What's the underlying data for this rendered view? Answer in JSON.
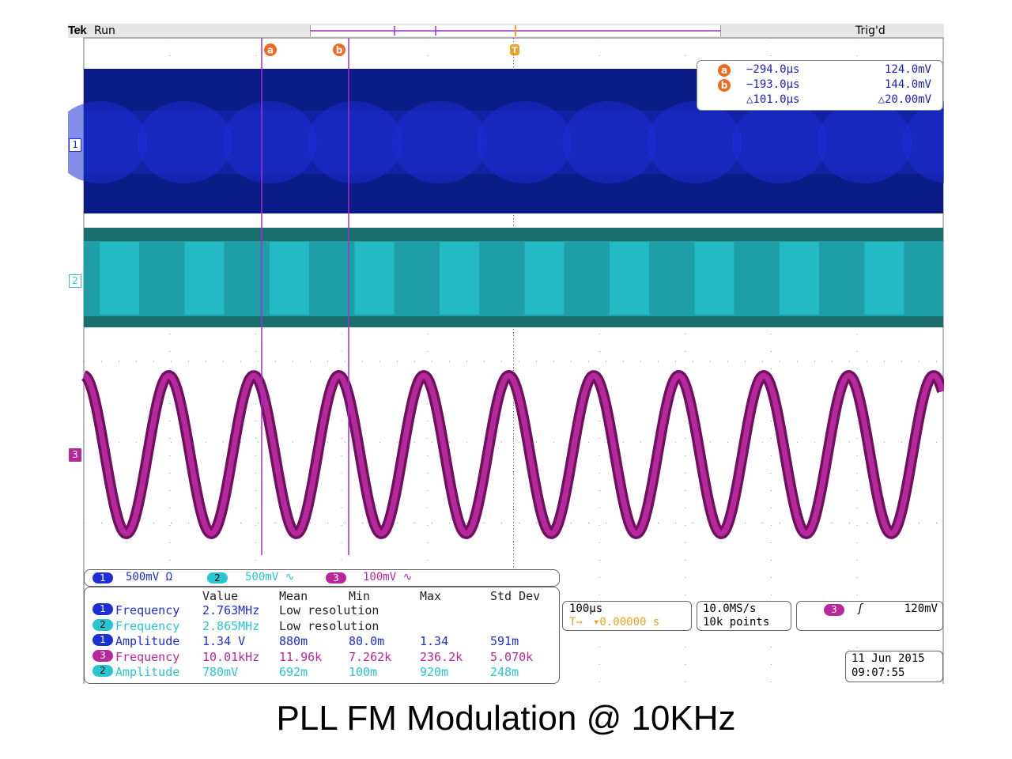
{
  "header": {
    "brand": "Tek",
    "run_state": "Run",
    "trigger_status": "Trig'd"
  },
  "channel_markers": {
    "ch1": "1",
    "ch2": "2",
    "ch3": "3"
  },
  "cursors": {
    "a_label": "a",
    "b_label": "b",
    "trigger_label": "T",
    "readout": {
      "a_time": "−294.0µs",
      "a_volt": "124.0mV",
      "b_time": "−193.0µs",
      "b_volt": "144.0mV",
      "delta_time": "△101.0µs",
      "delta_volt": "△20.00mV"
    }
  },
  "channel_settings": [
    {
      "num": "1",
      "scale": "500mV Ω",
      "color": "#1c2fd6"
    },
    {
      "num": "2",
      "scale": "500mV ∿",
      "color": "#27c6d1"
    },
    {
      "num": "3",
      "scale": "100mV ∿",
      "color": "#b8289d"
    }
  ],
  "measurements": {
    "headers": {
      "value": "Value",
      "mean": "Mean",
      "min": "Min",
      "max": "Max",
      "stddev": "Std Dev"
    },
    "rows": [
      {
        "ch": "1",
        "name": "Frequency",
        "value": "2.763MHz",
        "mean": "Low resolution",
        "min": "",
        "max": "",
        "stddev": "",
        "color": "#1c2fd6"
      },
      {
        "ch": "2",
        "name": "Frequency",
        "value": "2.865MHz",
        "mean": "Low resolution",
        "min": "",
        "max": "",
        "stddev": "",
        "color": "#27c6d1"
      },
      {
        "ch": "1",
        "name": "Amplitude",
        "value": "1.34 V",
        "mean": "880m",
        "min": "80.0m",
        "max": "1.34",
        "stddev": "591m",
        "color": "#1c2fd6"
      },
      {
        "ch": "3",
        "name": "Frequency",
        "value": "10.01kHz",
        "mean": "11.96k",
        "min": "7.262k",
        "max": "236.2k",
        "stddev": "5.070k",
        "color": "#b8289d"
      },
      {
        "ch": "2",
        "name": "Amplitude",
        "value": "780mV",
        "mean": "692m",
        "min": "100m",
        "max": "920m",
        "stddev": "248m",
        "color": "#27c6d1"
      }
    ]
  },
  "timebase": {
    "scale": "100µs",
    "position": "▾0.00000 s",
    "trigger_icon": "T→"
  },
  "acquisition": {
    "rate": "10.0MS/s",
    "points": "10k points"
  },
  "trigger": {
    "source": "3",
    "slope_icon": "rising-edge-icon",
    "slope_glyph": "ʃ",
    "level": "120mV"
  },
  "datetime": {
    "date": "11 Jun 2015",
    "time": "09:07:55"
  },
  "caption": "PLL FM Modulation @ 10KHz",
  "colors": {
    "ch1": "#1c2fd6",
    "ch1_dark": "#0c1c86",
    "ch2": "#27c6d1",
    "ch2_dark": "#1a6e6e",
    "ch3": "#b8289d",
    "ch3_dark": "#6e1260",
    "cursor": "#a530c8",
    "cursor_icon": "#ee6a1f",
    "trigger": "#f0a020"
  }
}
